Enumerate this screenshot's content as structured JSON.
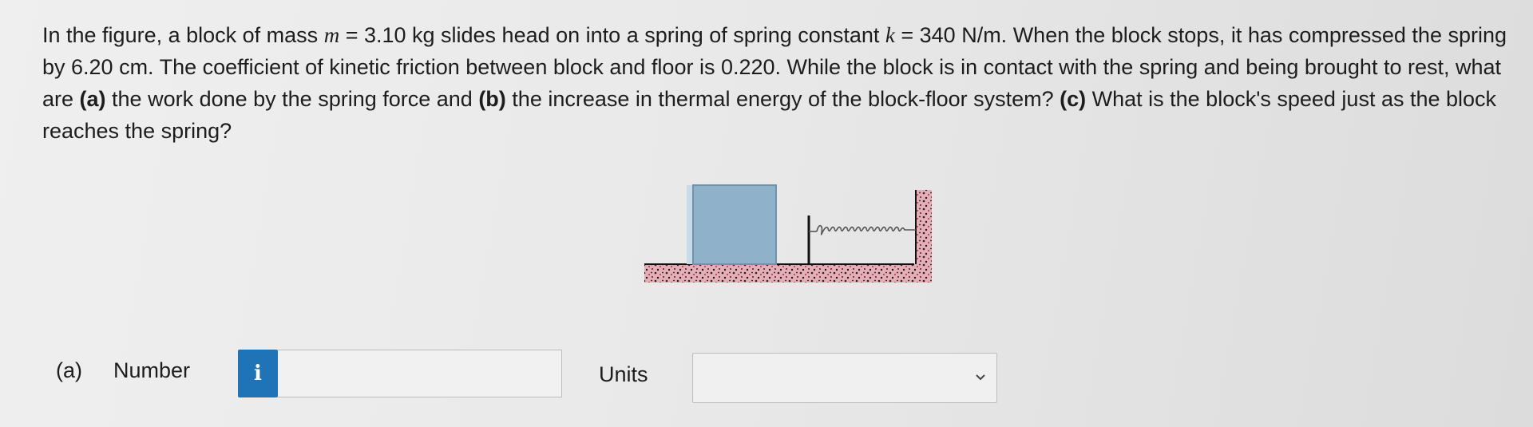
{
  "question": {
    "p1": "In the figure, a block of mass ",
    "m_var": "m",
    "p2": " = 3.10 kg slides head on into a spring of spring constant ",
    "k_var": "k",
    "p3": " = 340 N/m. When the block stops, it has compressed the spring by 6.20 cm. The coefficient of kinetic friction between block and floor is 0.220. While the block is in contact with the spring and being brought to rest, what are ",
    "a_label": "(a)",
    "p4": " the work done by the spring force and ",
    "b_label": "(b)",
    "p5": " the increase in thermal energy of the block-floor system? ",
    "c_label": "(c)",
    "p6": " What is the block's speed just as the block reaches the spring?"
  },
  "answer_row": {
    "part_label": "(a)",
    "number_label": "Number",
    "info_icon": "i",
    "number_value": "",
    "units_label": "Units",
    "units_selected": ""
  },
  "colors": {
    "block_fill": "#8fb1c9",
    "info_button": "#1f73b7",
    "floor_speckle": "#b3475a"
  },
  "icons": [
    "info-icon",
    "chevron-down-icon"
  ]
}
